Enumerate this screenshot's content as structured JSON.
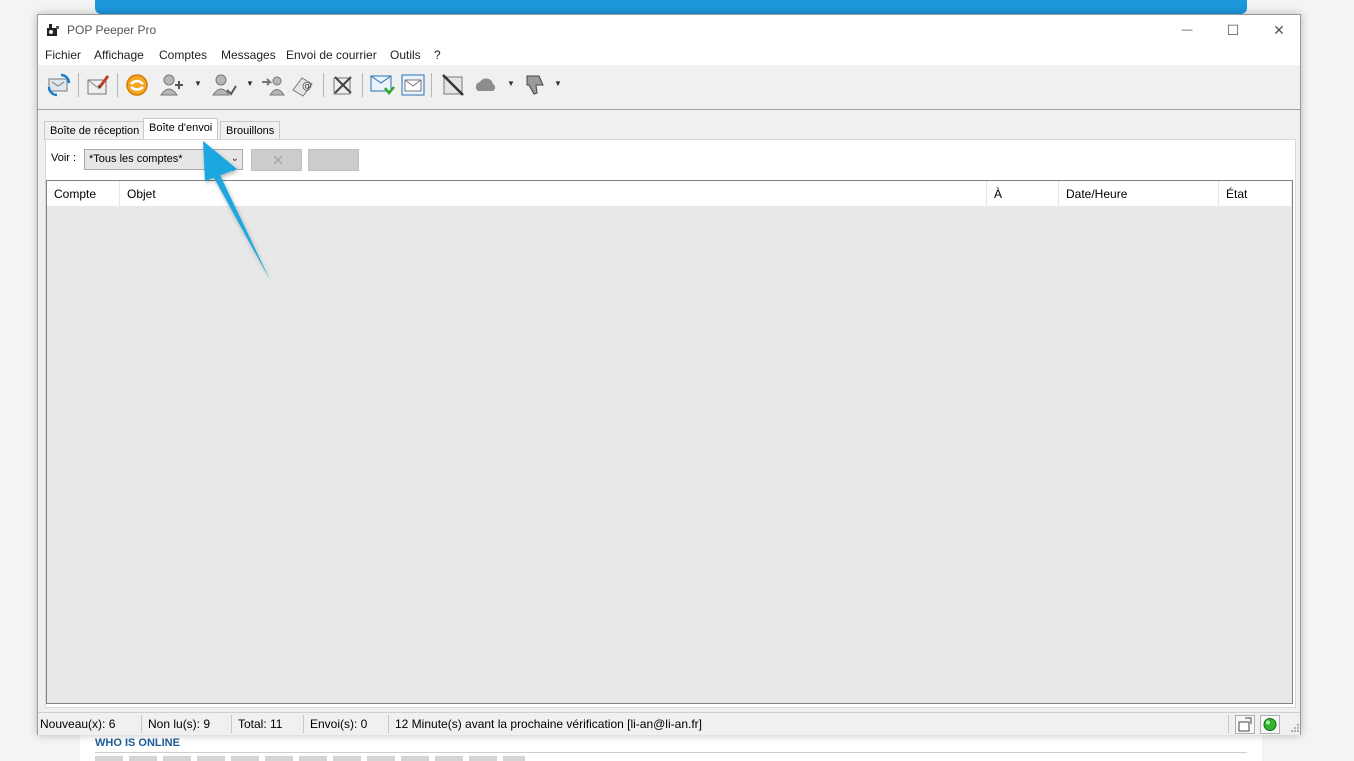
{
  "window": {
    "title": "POP Peeper Pro",
    "controls": {
      "minimize": "—",
      "maximize": "☐",
      "close": "✕"
    }
  },
  "menu": [
    "Fichier",
    "Affichage",
    "Comptes",
    "Messages",
    "Envoi de courrier",
    "Outils",
    "?"
  ],
  "toolbar": {
    "icons": [
      "refresh-icon",
      "compose-icon",
      "peeper-logo-icon",
      "add-account-icon",
      "account-options-icon",
      "import-accounts-icon",
      "email-settings-icon",
      "delete-mail-icon",
      "receive-icon",
      "inbox-view-icon",
      "block-sender-icon",
      "cloud-icon",
      "thumbs-down-icon"
    ]
  },
  "tabs": [
    {
      "label": "Boîte de réception"
    },
    {
      "label": "Boîte d'envoi"
    },
    {
      "label": "Brouillons"
    }
  ],
  "filter": {
    "label": "Voir :",
    "selected": "*Tous les comptes*"
  },
  "columns": [
    "Compte",
    "Objet",
    "À",
    "Date/Heure",
    "État"
  ],
  "status": {
    "nouveau": "Nouveau(x): 6",
    "non_lus": "Non lu(s): 9",
    "total": "Total: 11",
    "envoi": "Envoi(s): 0",
    "next_check": "12 Minute(s) avant la prochaine vérification [li-an@li-an.fr]"
  },
  "background_page": {
    "heading": "WHO IS ONLINE"
  },
  "colors": {
    "accent_arrow": "#1aa7e0",
    "banner": "#1c97dc",
    "status_led": "#2fb52f"
  }
}
